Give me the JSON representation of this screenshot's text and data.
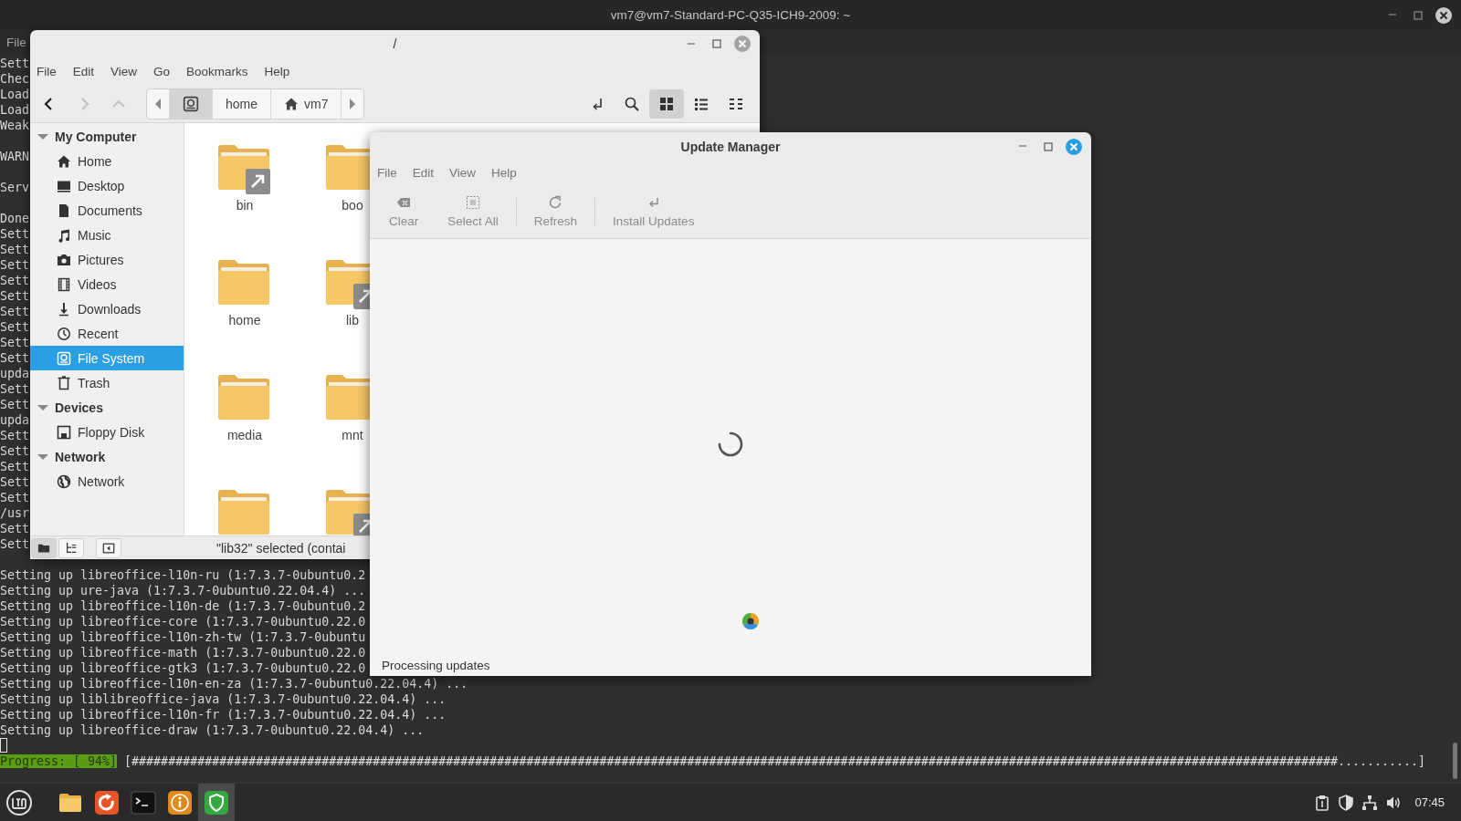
{
  "terminal": {
    "title": "vm7@vm7-Standard-PC-Q35-ICH9-2009: ~",
    "menu": [
      "File"
    ],
    "lines": [
      {
        "kind": "text",
        "text": "Sett"
      },
      {
        "kind": "text",
        "text": "Chec"
      },
      {
        "kind": "text",
        "text": "Load"
      },
      {
        "kind": "text",
        "text": "Load"
      },
      {
        "kind": "text",
        "text": "Weak"
      },
      {
        "kind": "blank"
      },
      {
        "kind": "text",
        "text": "WARN"
      },
      {
        "kind": "blank"
      },
      {
        "kind": "text",
        "text": "Serv"
      },
      {
        "kind": "blank"
      },
      {
        "kind": "text",
        "text": "Done"
      },
      {
        "kind": "text",
        "text": "Sett"
      },
      {
        "kind": "text",
        "text": "Sett"
      },
      {
        "kind": "text",
        "text": "Sett"
      },
      {
        "kind": "text",
        "text": "Sett"
      },
      {
        "kind": "text",
        "text": "Sett"
      },
      {
        "kind": "text",
        "text": "Sett"
      },
      {
        "kind": "text",
        "text": "Sett"
      },
      {
        "kind": "text",
        "text": "Sett"
      },
      {
        "kind": "text",
        "text": "Sett"
      },
      {
        "kind": "text",
        "text": "upda"
      },
      {
        "kind": "text",
        "text": "Sett"
      },
      {
        "kind": "text",
        "text": "Sett"
      },
      {
        "kind": "text",
        "text": "upda"
      },
      {
        "kind": "text",
        "text": "Sett"
      },
      {
        "kind": "text",
        "text": "Sett"
      },
      {
        "kind": "text",
        "text": "Sett"
      },
      {
        "kind": "text",
        "text": "Sett"
      },
      {
        "kind": "text",
        "text": "Sett"
      },
      {
        "kind": "text",
        "text": "/usr"
      },
      {
        "kind": "text",
        "text": "Sett"
      },
      {
        "kind": "text",
        "text": "Sett"
      },
      {
        "kind": "blank"
      },
      {
        "kind": "text",
        "text": "Setting up libreoffice-l10n-ru (1:7.3.7-0ubuntu0.2"
      },
      {
        "kind": "text",
        "text": "Setting up ure-java (1:7.3.7-0ubuntu0.22.04.4) ..."
      },
      {
        "kind": "text",
        "text": "Setting up libreoffice-l10n-de (1:7.3.7-0ubuntu0.2"
      },
      {
        "kind": "text",
        "text": "Setting up libreoffice-core (1:7.3.7-0ubuntu0.22.0"
      },
      {
        "kind": "text",
        "text": "Setting up libreoffice-l10n-zh-tw (1:7.3.7-0ubuntu"
      },
      {
        "kind": "text",
        "text": "Setting up libreoffice-math (1:7.3.7-0ubuntu0.22.0"
      },
      {
        "kind": "text",
        "text": "Setting up libreoffice-gtk3 (1:7.3.7-0ubuntu0.22.0"
      },
      {
        "kind": "text",
        "text": "Setting up libreoffice-l10n-en-za (1:7.3.7-0ubuntu0.22.04.4) ..."
      },
      {
        "kind": "text",
        "text": "Setting up liblibreoffice-java (1:7.3.7-0ubuntu0.22.04.4) ..."
      },
      {
        "kind": "text",
        "text": "Setting up libreoffice-l10n-fr (1:7.3.7-0ubuntu0.22.04.4) ..."
      },
      {
        "kind": "text",
        "text": "Setting up libreoffice-draw (1:7.3.7-0ubuntu0.22.04.4) ..."
      },
      {
        "kind": "cursor"
      }
    ],
    "progress": {
      "label": "Progress: [ 94%]",
      "bar": "[#####################################################################################################################################################################...........]"
    }
  },
  "file_manager": {
    "title": "/",
    "menu": [
      "File",
      "Edit",
      "View",
      "Go",
      "Bookmarks",
      "Help"
    ],
    "nav": [
      {
        "kind": "back",
        "disabled": false
      },
      {
        "kind": "forward",
        "disabled": true
      },
      {
        "kind": "up",
        "disabled": true
      }
    ],
    "path": [
      {
        "kind": "root",
        "selected": true
      },
      {
        "kind": "folder",
        "label": "home",
        "selected": false
      },
      {
        "kind": "home",
        "label": "vm7",
        "selected": false
      }
    ],
    "tools": [
      {
        "kind": "location"
      },
      {
        "kind": "search"
      }
    ],
    "views": [
      {
        "kind": "icons",
        "selected": true
      },
      {
        "kind": "list",
        "selected": false
      },
      {
        "kind": "compact",
        "selected": false
      }
    ],
    "sidebar": [
      {
        "title": "My Computer",
        "expanded": true,
        "items": [
          {
            "label": "Home",
            "kind": "home",
            "selected": false
          },
          {
            "label": "Desktop",
            "kind": "desktop",
            "selected": false
          },
          {
            "label": "Documents",
            "kind": "documents",
            "selected": false
          },
          {
            "label": "Music",
            "kind": "music",
            "selected": false
          },
          {
            "label": "Pictures",
            "kind": "pictures",
            "selected": false
          },
          {
            "label": "Videos",
            "kind": "videos",
            "selected": false
          },
          {
            "label": "Downloads",
            "kind": "downloads",
            "selected": false
          },
          {
            "label": "Recent",
            "kind": "recent",
            "selected": false
          },
          {
            "label": "File System",
            "kind": "filesystem",
            "selected": true
          },
          {
            "label": "Trash",
            "kind": "trash",
            "selected": false
          }
        ]
      },
      {
        "title": "Devices",
        "expanded": true,
        "items": [
          {
            "label": "Floppy Disk",
            "kind": "floppy",
            "selected": false
          }
        ]
      },
      {
        "title": "Network",
        "expanded": true,
        "items": [
          {
            "label": "Network",
            "kind": "network",
            "selected": false
          }
        ]
      }
    ],
    "files": [
      {
        "name": "bin",
        "link": true
      },
      {
        "name": "boo",
        "link": false
      },
      {
        "name": "home",
        "link": false
      },
      {
        "name": "lib",
        "link": true
      },
      {
        "name": "media",
        "link": false
      },
      {
        "name": "mnt",
        "link": false
      },
      {
        "link": false
      },
      {
        "link": true
      }
    ],
    "status_buttons": [
      {
        "kind": "places",
        "selected": true
      },
      {
        "kind": "tree",
        "selected": false
      },
      {
        "kind": "sidebar",
        "selected": false
      }
    ],
    "status": "\"lib32\" selected (contai"
  },
  "update_manager": {
    "title": "Update Manager",
    "menu": [
      "File",
      "Edit",
      "View",
      "Help"
    ],
    "toolbar": [
      {
        "kind": "clear",
        "label": "Clear",
        "disabled": true,
        "separator_before": false
      },
      {
        "kind": "select-all",
        "label": "Select All",
        "disabled": true,
        "separator_before": false
      },
      {
        "kind": "refresh",
        "label": "Refresh",
        "disabled": true,
        "separator_before": true
      },
      {
        "kind": "install",
        "label": "Install Updates",
        "disabled": true,
        "separator_before": true
      }
    ],
    "status": "Processing updates"
  },
  "taskbar": {
    "apps": [
      {
        "kind": "files",
        "selected": false
      },
      {
        "kind": "browser",
        "selected": false
      },
      {
        "kind": "terminal",
        "selected": false
      },
      {
        "kind": "info",
        "selected": false
      },
      {
        "kind": "shield",
        "selected": true
      }
    ],
    "tray": [
      {
        "kind": "clipboard"
      },
      {
        "kind": "shield"
      },
      {
        "kind": "network"
      },
      {
        "kind": "volume"
      }
    ],
    "clock": "07:45"
  }
}
